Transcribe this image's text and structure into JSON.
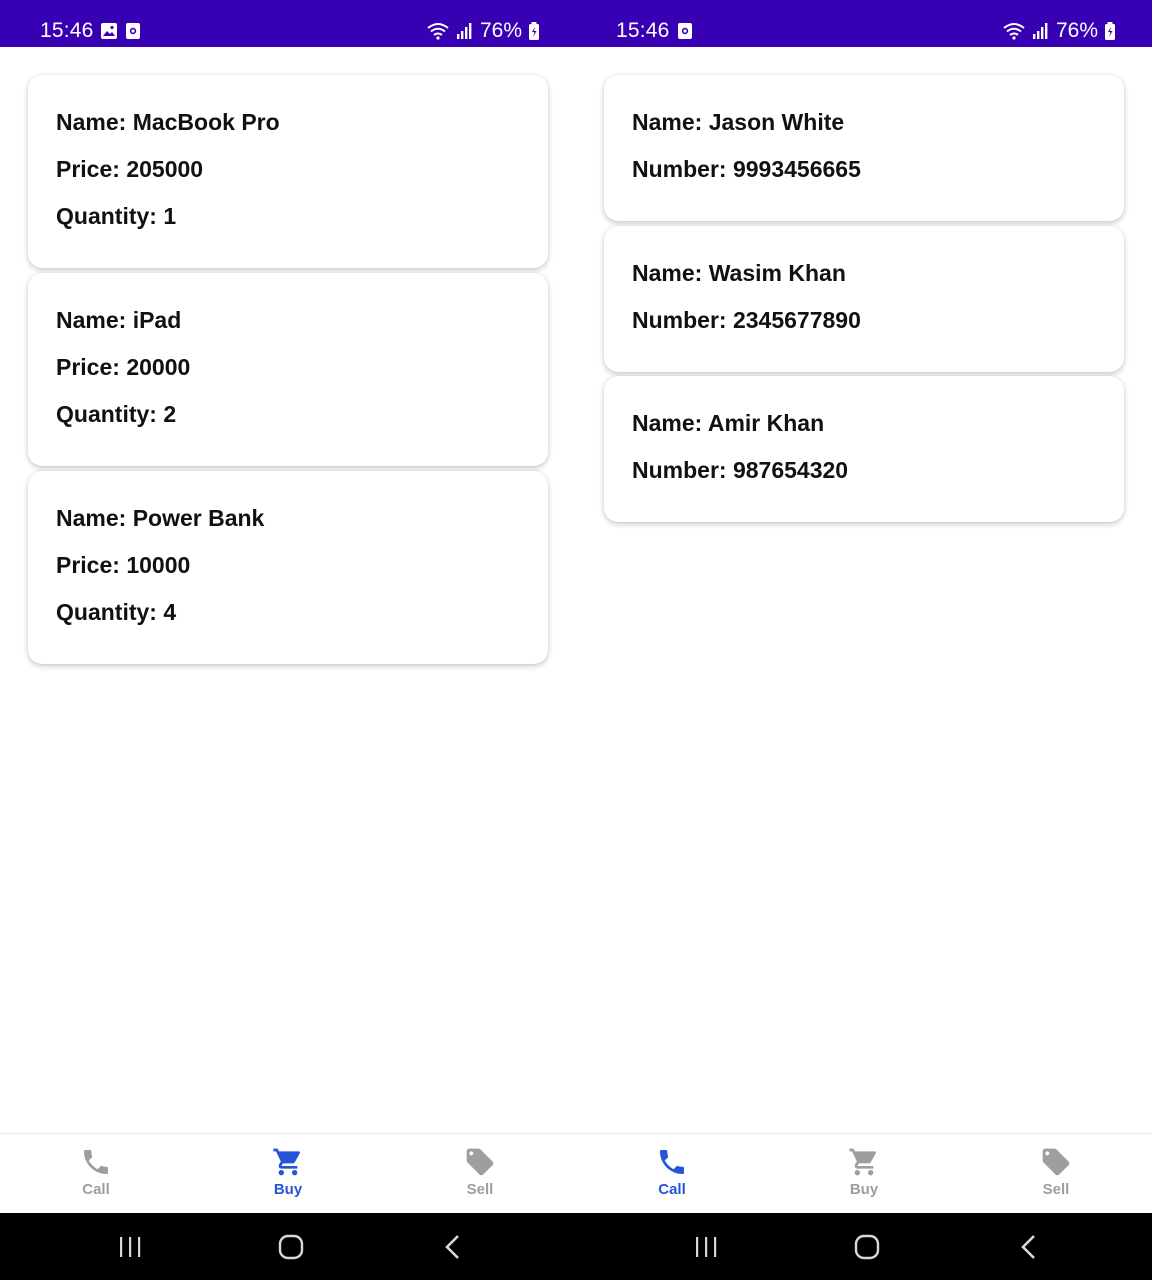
{
  "colors": {
    "status_bar": "#3700b3",
    "nav_active": "#2554d9",
    "nav_inactive": "#9e9e9e",
    "system_nav": "#000000"
  },
  "left_screen": {
    "status_bar": {
      "time": "15:46",
      "battery": "76%",
      "left_icons": [
        "gallery-icon",
        "screen-record-icon"
      ]
    },
    "cards": [
      {
        "name": "Name: MacBook Pro",
        "price": "Price: 205000",
        "quantity": "Quantity: 1"
      },
      {
        "name": "Name: iPad",
        "price": "Price: 20000",
        "quantity": "Quantity: 2"
      },
      {
        "name": "Name: Power Bank",
        "price": "Price: 10000",
        "quantity": "Quantity: 4"
      }
    ],
    "bottom_nav": {
      "active": "Buy",
      "items": [
        {
          "label": "Call",
          "icon": "phone-icon"
        },
        {
          "label": "Buy",
          "icon": "cart-icon"
        },
        {
          "label": "Sell",
          "icon": "tag-icon"
        }
      ]
    }
  },
  "right_screen": {
    "status_bar": {
      "time": "15:46",
      "battery": "76%",
      "left_icons": [
        "screen-record-icon"
      ]
    },
    "cards": [
      {
        "name": "Name: Jason White",
        "number": "Number: 9993456665"
      },
      {
        "name": "Name: Wasim Khan",
        "number": "Number: 2345677890"
      },
      {
        "name": "Name: Amir Khan",
        "number": "Number: 987654320"
      }
    ],
    "bottom_nav": {
      "active": "Call",
      "items": [
        {
          "label": "Call",
          "icon": "phone-icon"
        },
        {
          "label": "Buy",
          "icon": "cart-icon"
        },
        {
          "label": "Sell",
          "icon": "tag-icon"
        }
      ]
    }
  },
  "system_nav": [
    "recents-button",
    "home-button",
    "back-button"
  ]
}
